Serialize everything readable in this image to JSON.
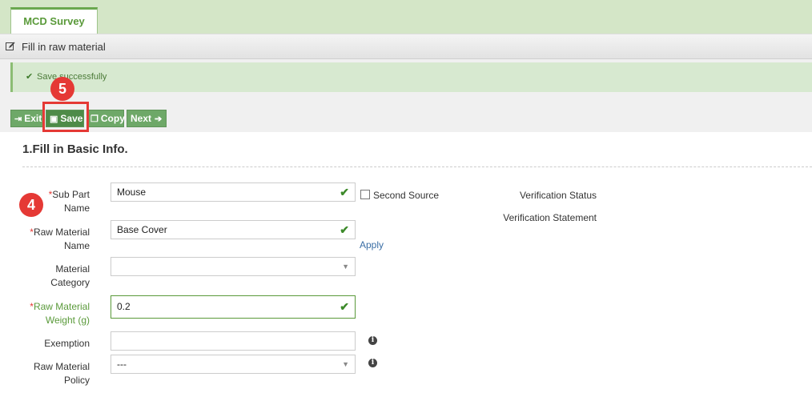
{
  "tabs": [
    {
      "label": "MCD Survey"
    }
  ],
  "page_title": "Fill in raw material",
  "alert": {
    "message": "Save successfully"
  },
  "toolbar": {
    "exit_label": "Exit",
    "save_label": "Save",
    "copy_label": "Copy",
    "next_label": "Next"
  },
  "annotations": {
    "badge_5": "5",
    "badge_4": "4"
  },
  "section": {
    "title": "1.Fill in Basic Info."
  },
  "form": {
    "required_mark": "*",
    "sub_part_name": {
      "label_line1": "Sub Part",
      "label_line2": "Name",
      "value": "Mouse"
    },
    "second_source": {
      "label": "Second Source",
      "checked": false
    },
    "raw_material_name": {
      "label_line1": "Raw Material",
      "label_line2": "Name",
      "value": "Base Cover"
    },
    "apply_link": "Apply",
    "material_category": {
      "label_line1": "Material",
      "label_line2": "Category",
      "value": ""
    },
    "raw_material_weight": {
      "label_line1": "Raw Material",
      "label_line2": "Weight (g)",
      "value": "0.2"
    },
    "exemption": {
      "label": "Exemption",
      "value": ""
    },
    "raw_material_policy": {
      "label_line1": "Raw Material",
      "label_line2": "Policy",
      "value": "---"
    }
  },
  "verification": {
    "status_label": "Verification Status",
    "statement_label": "Verification Statement"
  },
  "icons": {
    "edit": "edit-icon",
    "check": "check-icon",
    "exit": "sign-out-icon",
    "save": "floppy-disk-icon",
    "copy": "copy-icon",
    "next": "arrow-right-icon",
    "info": "info-circle-icon",
    "caret": "caret-down-icon"
  },
  "colors": {
    "brand_green": "#6ea868",
    "tab_bar": "#d4e6c7",
    "alert_bg": "#d7e9d0",
    "badge_red": "#e53935",
    "required_red": "#e53935"
  }
}
